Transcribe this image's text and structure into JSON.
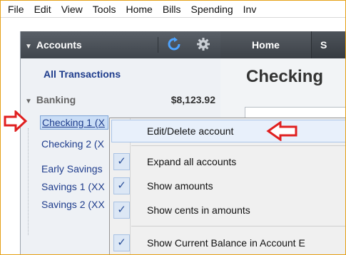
{
  "menubar": {
    "items": [
      "File",
      "Edit",
      "View",
      "Tools",
      "Home",
      "Bills",
      "Spending",
      "Inv"
    ]
  },
  "sidebar": {
    "header_title": "Accounts",
    "all_transactions": "All Transactions",
    "group_label": "Banking",
    "group_total": "$8,123.92",
    "accounts": [
      "Checking 1 (X",
      "Checking 2 (X",
      "Early Savings",
      "Savings 1 (XX",
      "Savings 2 (XX"
    ]
  },
  "topnav": {
    "home_tab": "Home",
    "next_tab": "S"
  },
  "main": {
    "page_title": "Checking"
  },
  "context_menu": {
    "edit_delete": "Edit/Delete account",
    "expand_all": "Expand all accounts",
    "show_amounts": "Show amounts",
    "show_cents": "Show cents in amounts",
    "show_current_balance": "Show Current Balance in Account E",
    "check_mark": "✓"
  },
  "colors": {
    "annotation_red": "#e02020",
    "link_blue": "#1e3c8c",
    "frame_orange": "#e6a117"
  },
  "icons": {
    "refresh": "refresh-icon",
    "settings": "gear-icon"
  }
}
